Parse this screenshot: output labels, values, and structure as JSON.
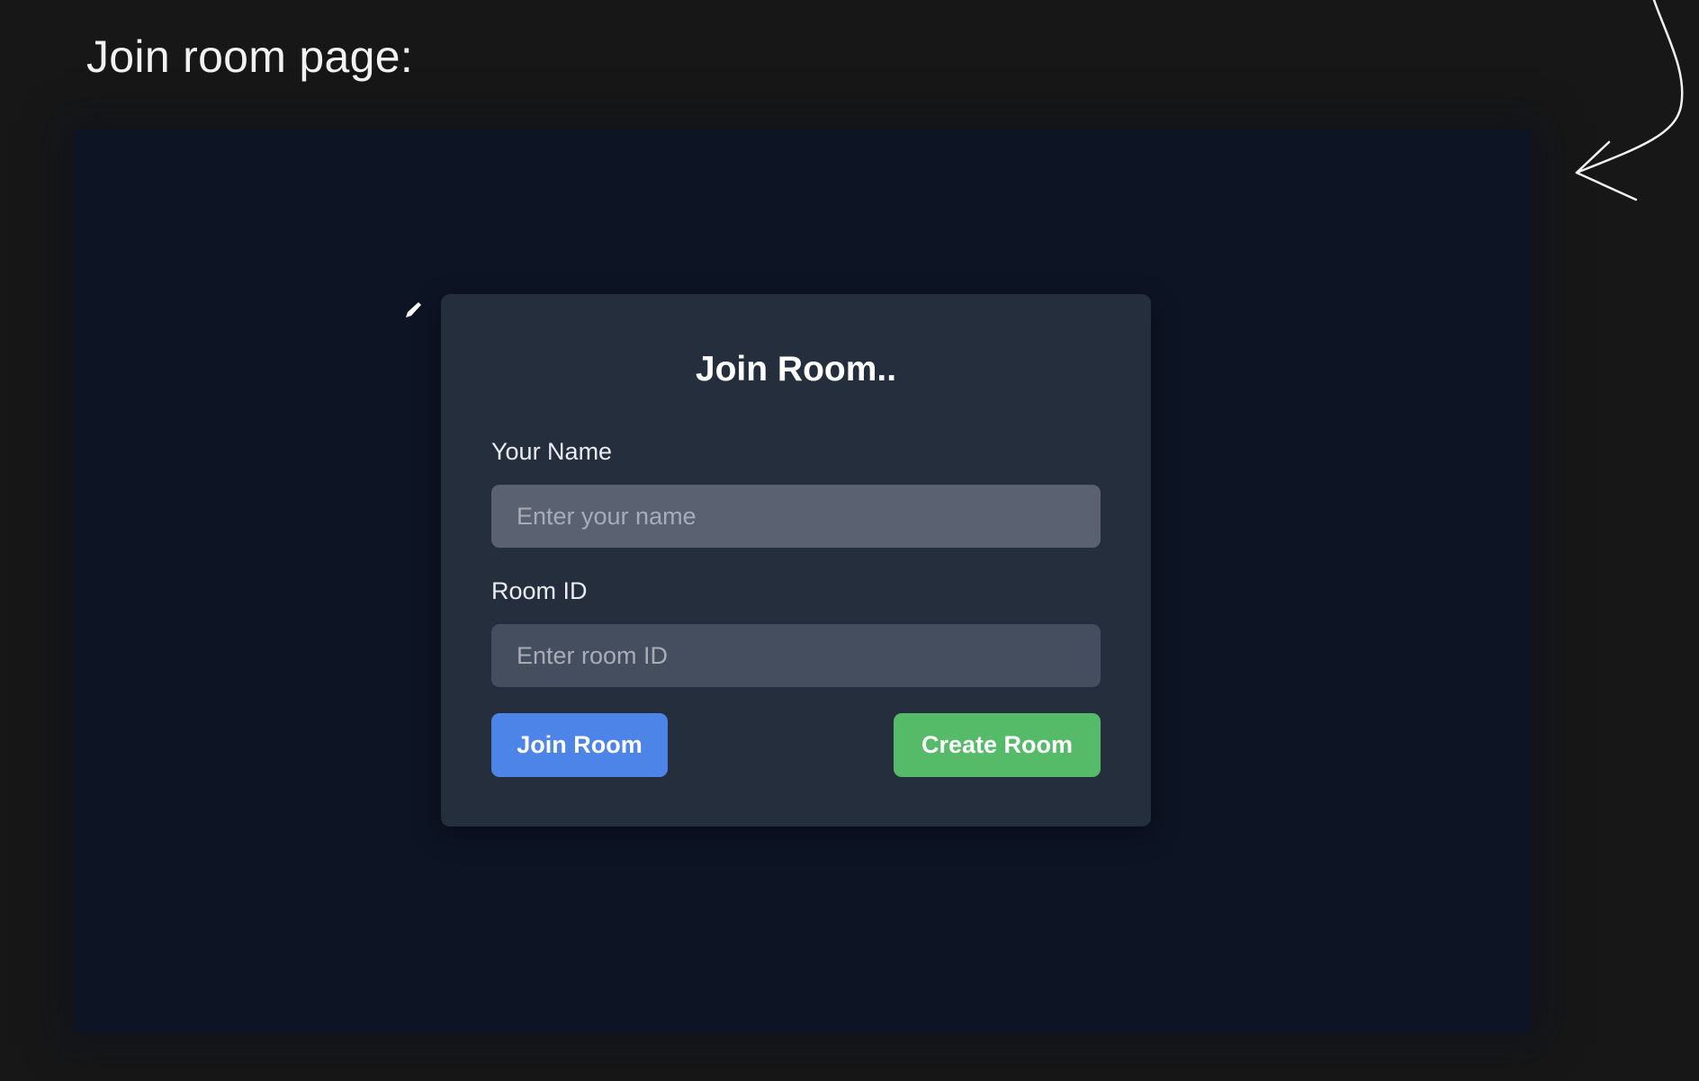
{
  "slide": {
    "heading": "Join room page:"
  },
  "card": {
    "title": "Join Room..",
    "name_field": {
      "label": "Your Name",
      "placeholder": "Enter your name",
      "value": ""
    },
    "room_field": {
      "label": "Room ID",
      "placeholder": "Enter room ID",
      "value": ""
    },
    "join_button": "Join Room",
    "create_button": "Create Room"
  },
  "icons": {
    "annotation_arrow": "curved-arrow-icon",
    "cursor": "pencil-icon"
  },
  "colors": {
    "page_background": "#171717",
    "app_background": "#0d1424",
    "card_background": "#252e3d",
    "join_button": "#4d84e8",
    "create_button": "#55bb68"
  }
}
